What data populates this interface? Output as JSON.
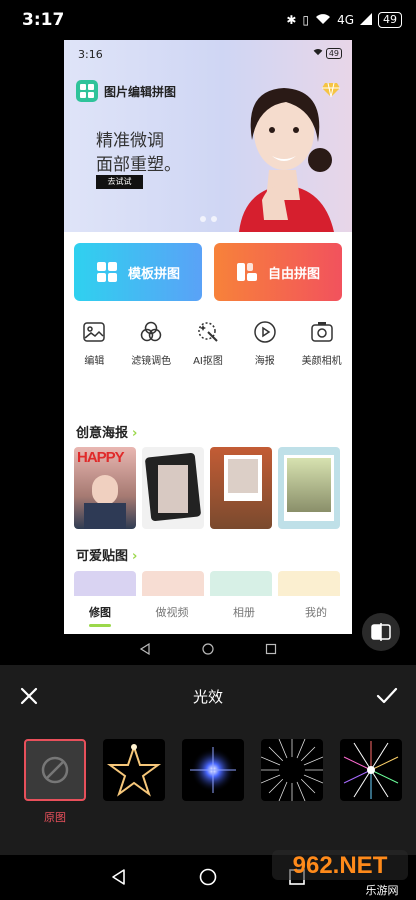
{
  "status_bar": {
    "time": "3:17",
    "signal": "4G",
    "battery": "49"
  },
  "preview": {
    "status_time": "3:16",
    "status_battery": "49",
    "app_title": "图片编辑拼图",
    "slogan_line1": "精准微调",
    "slogan_line2": "面部重塑。",
    "try_button": "去试试",
    "main_buttons": [
      {
        "label": "模板拼图"
      },
      {
        "label": "自由拼图"
      }
    ],
    "tools": [
      {
        "label": "编辑",
        "icon": "image-icon"
      },
      {
        "label": "滤镜调色",
        "icon": "filter-circles-icon"
      },
      {
        "label": "AI抠图",
        "icon": "magic-wand-icon"
      },
      {
        "label": "海报",
        "icon": "play-circle-icon"
      },
      {
        "label": "美颜相机",
        "icon": "camera-icon"
      }
    ],
    "section_posters": "创意海报",
    "poster_text": "HAPPY",
    "section_stickers": "可爱贴图",
    "tabs": [
      {
        "label": "修图",
        "active": true
      },
      {
        "label": "做视频",
        "active": false
      },
      {
        "label": "相册",
        "active": false
      },
      {
        "label": "我的",
        "active": false
      }
    ]
  },
  "panel": {
    "title": "光效",
    "effects": [
      {
        "name": "原图",
        "selected": true
      },
      {
        "name": "star-light"
      },
      {
        "name": "blue-flare"
      },
      {
        "name": "radial-burst"
      },
      {
        "name": "rainbow-burst"
      }
    ]
  },
  "watermark": {
    "site": "962.NET",
    "subtitle": "乐游网"
  },
  "colors": {
    "accent_green": "#9bd84b",
    "selected_red": "#e8505b",
    "panel_bg": "#1c1c1c"
  }
}
